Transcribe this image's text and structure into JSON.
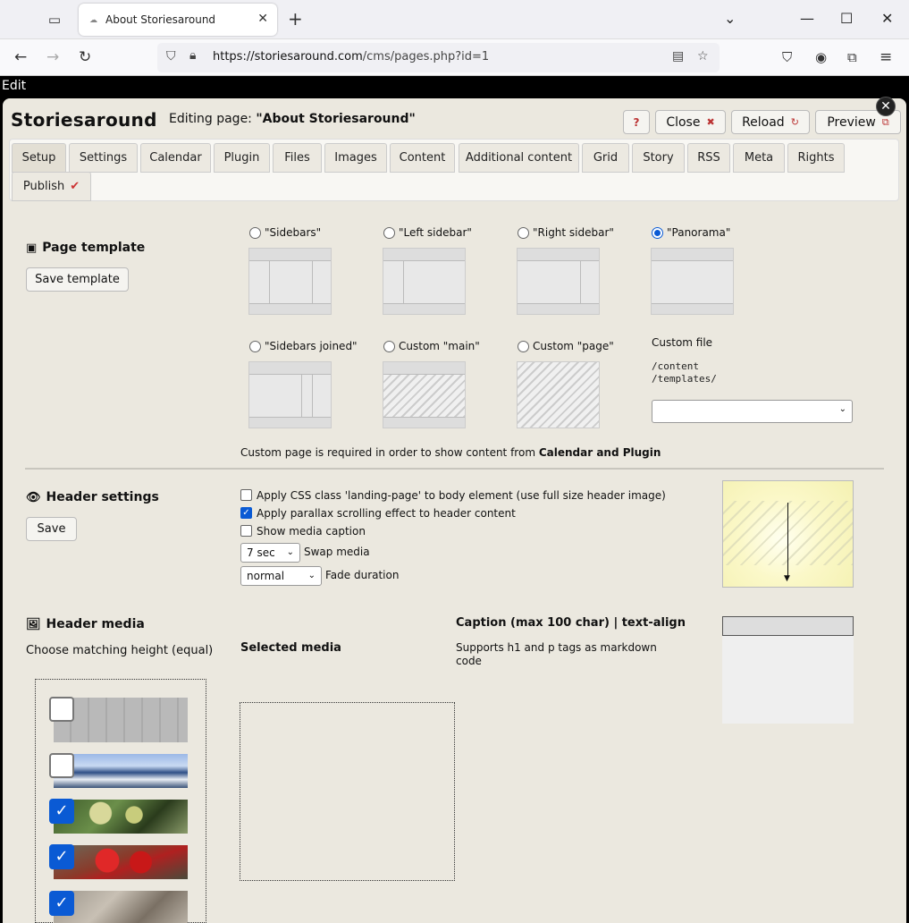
{
  "browser": {
    "tab_title": "About Storiesaround",
    "url_host": "https://storiesaround.com",
    "url_path": "/cms/pages.php?id=1"
  },
  "page": {
    "edit_label": "Edit"
  },
  "cms": {
    "logo": "Storiesaround",
    "editing_prefix": "Editing page:",
    "editing_title": "\"About Storiesaround\"",
    "buttons": {
      "help": "?",
      "close": "Close",
      "reload": "Reload",
      "preview": "Preview"
    },
    "tabs": [
      "Setup",
      "Settings",
      "Calendar",
      "Plugin",
      "Files",
      "Images",
      "Content",
      "Additional content",
      "Grid",
      "Story",
      "RSS",
      "Meta",
      "Rights",
      "Publish"
    ]
  },
  "template": {
    "title": "Page template",
    "save_button": "Save template",
    "options": [
      "\"Sidebars\"",
      "\"Left sidebar\"",
      "\"Right sidebar\"",
      "\"Panorama\"",
      "\"Sidebars joined\"",
      "Custom \"main\"",
      "Custom \"page\""
    ],
    "selected": "\"Panorama\"",
    "custom_file_label": "Custom file",
    "custom_path_1": "/content",
    "custom_path_2": "/templates/",
    "custom_select_value": "",
    "note_prefix": "Custom page is required in order to show content from",
    "note_bold": "Calendar and Plugin"
  },
  "header_settings": {
    "title": "Header settings",
    "save_button": "Save",
    "opt_landing": "Apply CSS class 'landing-page' to body element (use full size header image)",
    "opt_parallax": "Apply parallax scrolling effect to header content",
    "opt_caption": "Show media caption",
    "landing_checked": false,
    "parallax_checked": true,
    "caption_checked": false,
    "swap_value": "7 sec",
    "swap_label": "Swap media",
    "fade_value": "normal",
    "fade_label": "Fade duration"
  },
  "header_media": {
    "title": "Header media",
    "subtitle": "Choose matching height (equal)",
    "selected_label": "Selected media",
    "caption_title": "Caption (max 100 char) | text-align",
    "caption_help": "Supports h1 and p tags as markdown",
    "caption_help_2": "code",
    "thumbs_checked": [
      false,
      false,
      true,
      true,
      true
    ]
  },
  "colors": {
    "accent": "#0a5ad4",
    "panel_bg": "#ebe8df"
  }
}
